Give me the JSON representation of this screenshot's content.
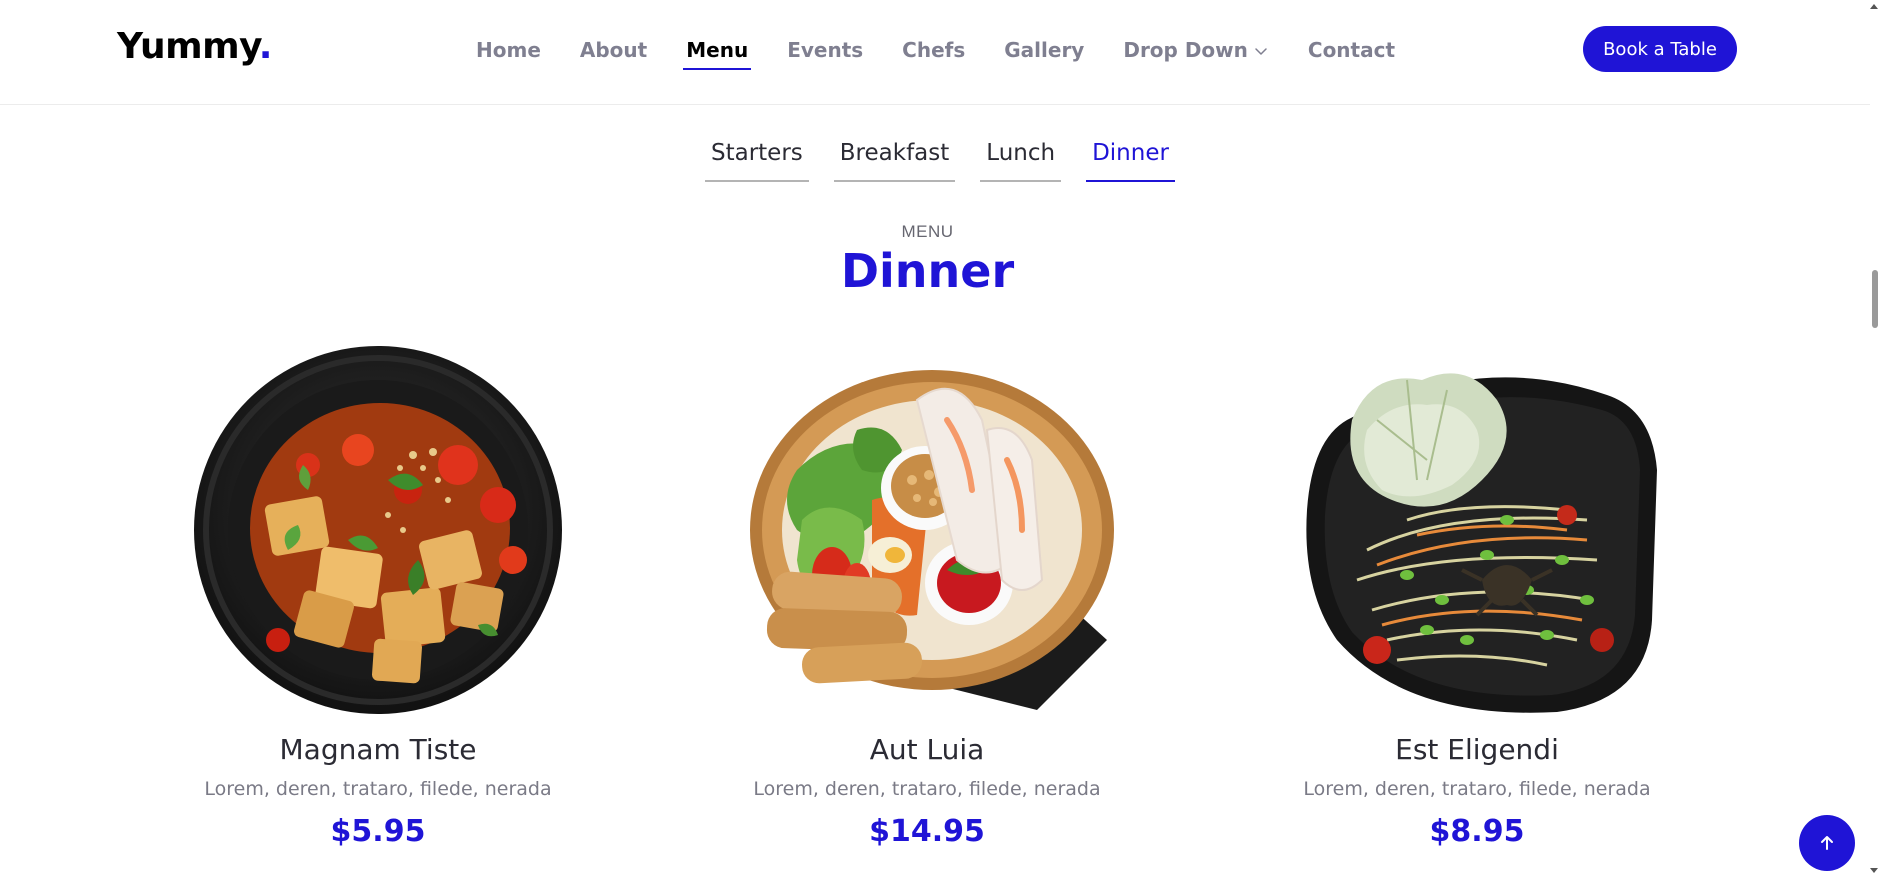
{
  "header": {
    "logo_text": "Yummy",
    "logo_dot": ".",
    "nav": [
      {
        "label": "Home"
      },
      {
        "label": "About"
      },
      {
        "label": "Menu",
        "active": true
      },
      {
        "label": "Events"
      },
      {
        "label": "Chefs"
      },
      {
        "label": "Gallery"
      },
      {
        "label": "Drop Down",
        "has_dropdown": true
      },
      {
        "label": "Contact"
      }
    ],
    "cta_label": "Book a Table"
  },
  "tabs": [
    {
      "label": "Starters"
    },
    {
      "label": "Breakfast"
    },
    {
      "label": "Lunch"
    },
    {
      "label": "Dinner",
      "active": true
    }
  ],
  "section": {
    "subtitle": "MENU",
    "title": "Dinner"
  },
  "items": [
    {
      "name": "Magnam Tiste",
      "ingredients": "Lorem, deren, trataro, filede, nerada",
      "price": "$5.95",
      "image": "tofu-stir-fry-round-plate"
    },
    {
      "name": "Aut Luia",
      "ingredients": "Lorem, deren, trataro, filede, nerada",
      "price": "$14.95",
      "image": "spring-roll-basket-platter"
    },
    {
      "name": "Est Eligendi",
      "ingredients": "Lorem, deren, trataro, filede, nerada",
      "price": "$8.95",
      "image": "papaya-salad-square-plate"
    }
  ],
  "colors": {
    "accent": "#1f14d6",
    "text_dark": "#2b2b34",
    "text_muted": "#7a7a86",
    "nav_muted": "#7f7f90"
  },
  "icons": {
    "dropdown": "chevron-down-icon",
    "scroll_top": "arrow-up-icon"
  }
}
